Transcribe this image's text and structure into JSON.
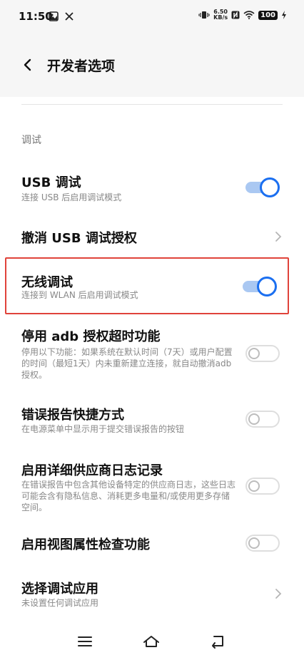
{
  "status_bar": {
    "time": "11:50",
    "left_icons": [
      "gallery-icon",
      "tools-icon"
    ],
    "net_speed_value": "6.50",
    "net_speed_unit": "KB/s",
    "battery": "100"
  },
  "header": {
    "title": "开发者选项"
  },
  "section": {
    "label": "调试"
  },
  "settings": [
    {
      "title": "USB 调试",
      "subtitle": "连接 USB 后启用调试模式",
      "control": "toggle",
      "on": true
    },
    {
      "title": "撤消 USB 调试授权",
      "subtitle": "",
      "control": "chevron"
    },
    {
      "title": "无线调试",
      "subtitle": "连接到 WLAN 后启用调试模式",
      "control": "toggle",
      "on": true,
      "highlighted": true
    },
    {
      "title": "停用 adb 授权超时功能",
      "subtitle": "停用以下功能：如果系统在默认时间（7天）或用户配置的时间（最短1天）内未重新建立连接，就自动撤消adb授权。",
      "control": "toggle",
      "on": false
    },
    {
      "title": "错误报告快捷方式",
      "subtitle": "在电源菜单中显示用于提交错误报告的按钮",
      "control": "toggle",
      "on": false
    },
    {
      "title": "启用详细供应商日志记录",
      "subtitle": "在错误报告中包含其他设备特定的供应商日志，这些日志可能会含有隐私信息、消耗更多电量和/或使用更多存储空间。",
      "control": "toggle",
      "on": false
    },
    {
      "title": "启用视图属性检查功能",
      "subtitle": "",
      "control": "toggle",
      "on": false
    },
    {
      "title": "选择调试应用",
      "subtitle": "未设置任何调试应用",
      "control": "chevron"
    }
  ],
  "colors": {
    "accent": "#1b6ff0",
    "highlight": "#e0433a"
  },
  "nav_bar": {
    "buttons": [
      "menu-icon",
      "home-icon",
      "back-icon"
    ]
  }
}
